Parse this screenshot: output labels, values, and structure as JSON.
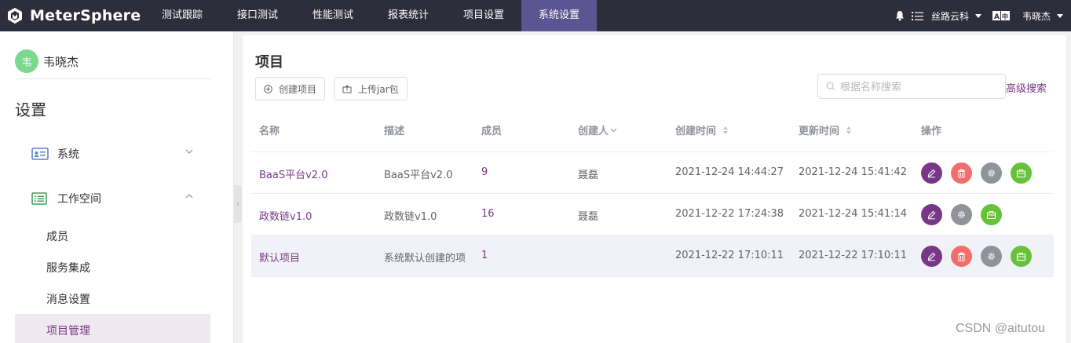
{
  "app": {
    "logo_text": "MeterSphere",
    "nav": [
      "测试跟踪",
      "接口测试",
      "性能测试",
      "报表统计",
      "项目设置",
      "系统设置"
    ],
    "active_nav": "系统设置",
    "workspace": "丝路云科",
    "language_icon": "language-icon",
    "username": "韦晓杰"
  },
  "sidebar": {
    "avatar_char": "韦",
    "user_name": "韦晓杰",
    "title": "设置",
    "menus": [
      {
        "label": "系统",
        "icon": "system-icon",
        "expanded": false
      },
      {
        "label": "工作空间",
        "icon": "workspace-icon",
        "expanded": true
      }
    ],
    "submenu": [
      "成员",
      "服务集成",
      "消息设置",
      "项目管理"
    ],
    "active_submenu": "项目管理"
  },
  "main": {
    "title": "项目",
    "create_button": "创建项目",
    "upload_button": "上传jar包",
    "search_placeholder": "根据名称搜索",
    "advanced_search": "高级搜索",
    "columns": [
      "名称",
      "描述",
      "成员",
      "创建人",
      "创建时间",
      "更新时间",
      "操作"
    ],
    "rows": [
      {
        "name": "BaaS平台v2.0",
        "desc": "BaaS平台v2.0",
        "members": "9",
        "creator": "聂磊",
        "created": "2021-12-24 14:44:27",
        "updated": "2021-12-24 15:41:42",
        "actions": [
          "edit",
          "delete",
          "settings",
          "jar"
        ]
      },
      {
        "name": "政数链v1.0",
        "desc": "政数链v1.0",
        "members": "16",
        "creator": "聂磊",
        "created": "2021-12-22 17:24:38",
        "updated": "2021-12-24 15:41:14",
        "actions": [
          "edit",
          "settings",
          "jar"
        ]
      },
      {
        "name": "默认项目",
        "desc": "系统默认创建的项",
        "members": "1",
        "creator": "",
        "created": "2021-12-22 17:10:11",
        "updated": "2021-12-22 17:10:11",
        "actions": [
          "edit",
          "delete",
          "settings",
          "jar"
        ]
      }
    ]
  },
  "watermark": "CSDN @aitutou",
  "colors": {
    "topbar": "#2d2d3b",
    "active_nav": "#5c5591",
    "primary": "#783887",
    "danger": "#f56c6c",
    "info": "#909399",
    "success": "#67c23a"
  }
}
